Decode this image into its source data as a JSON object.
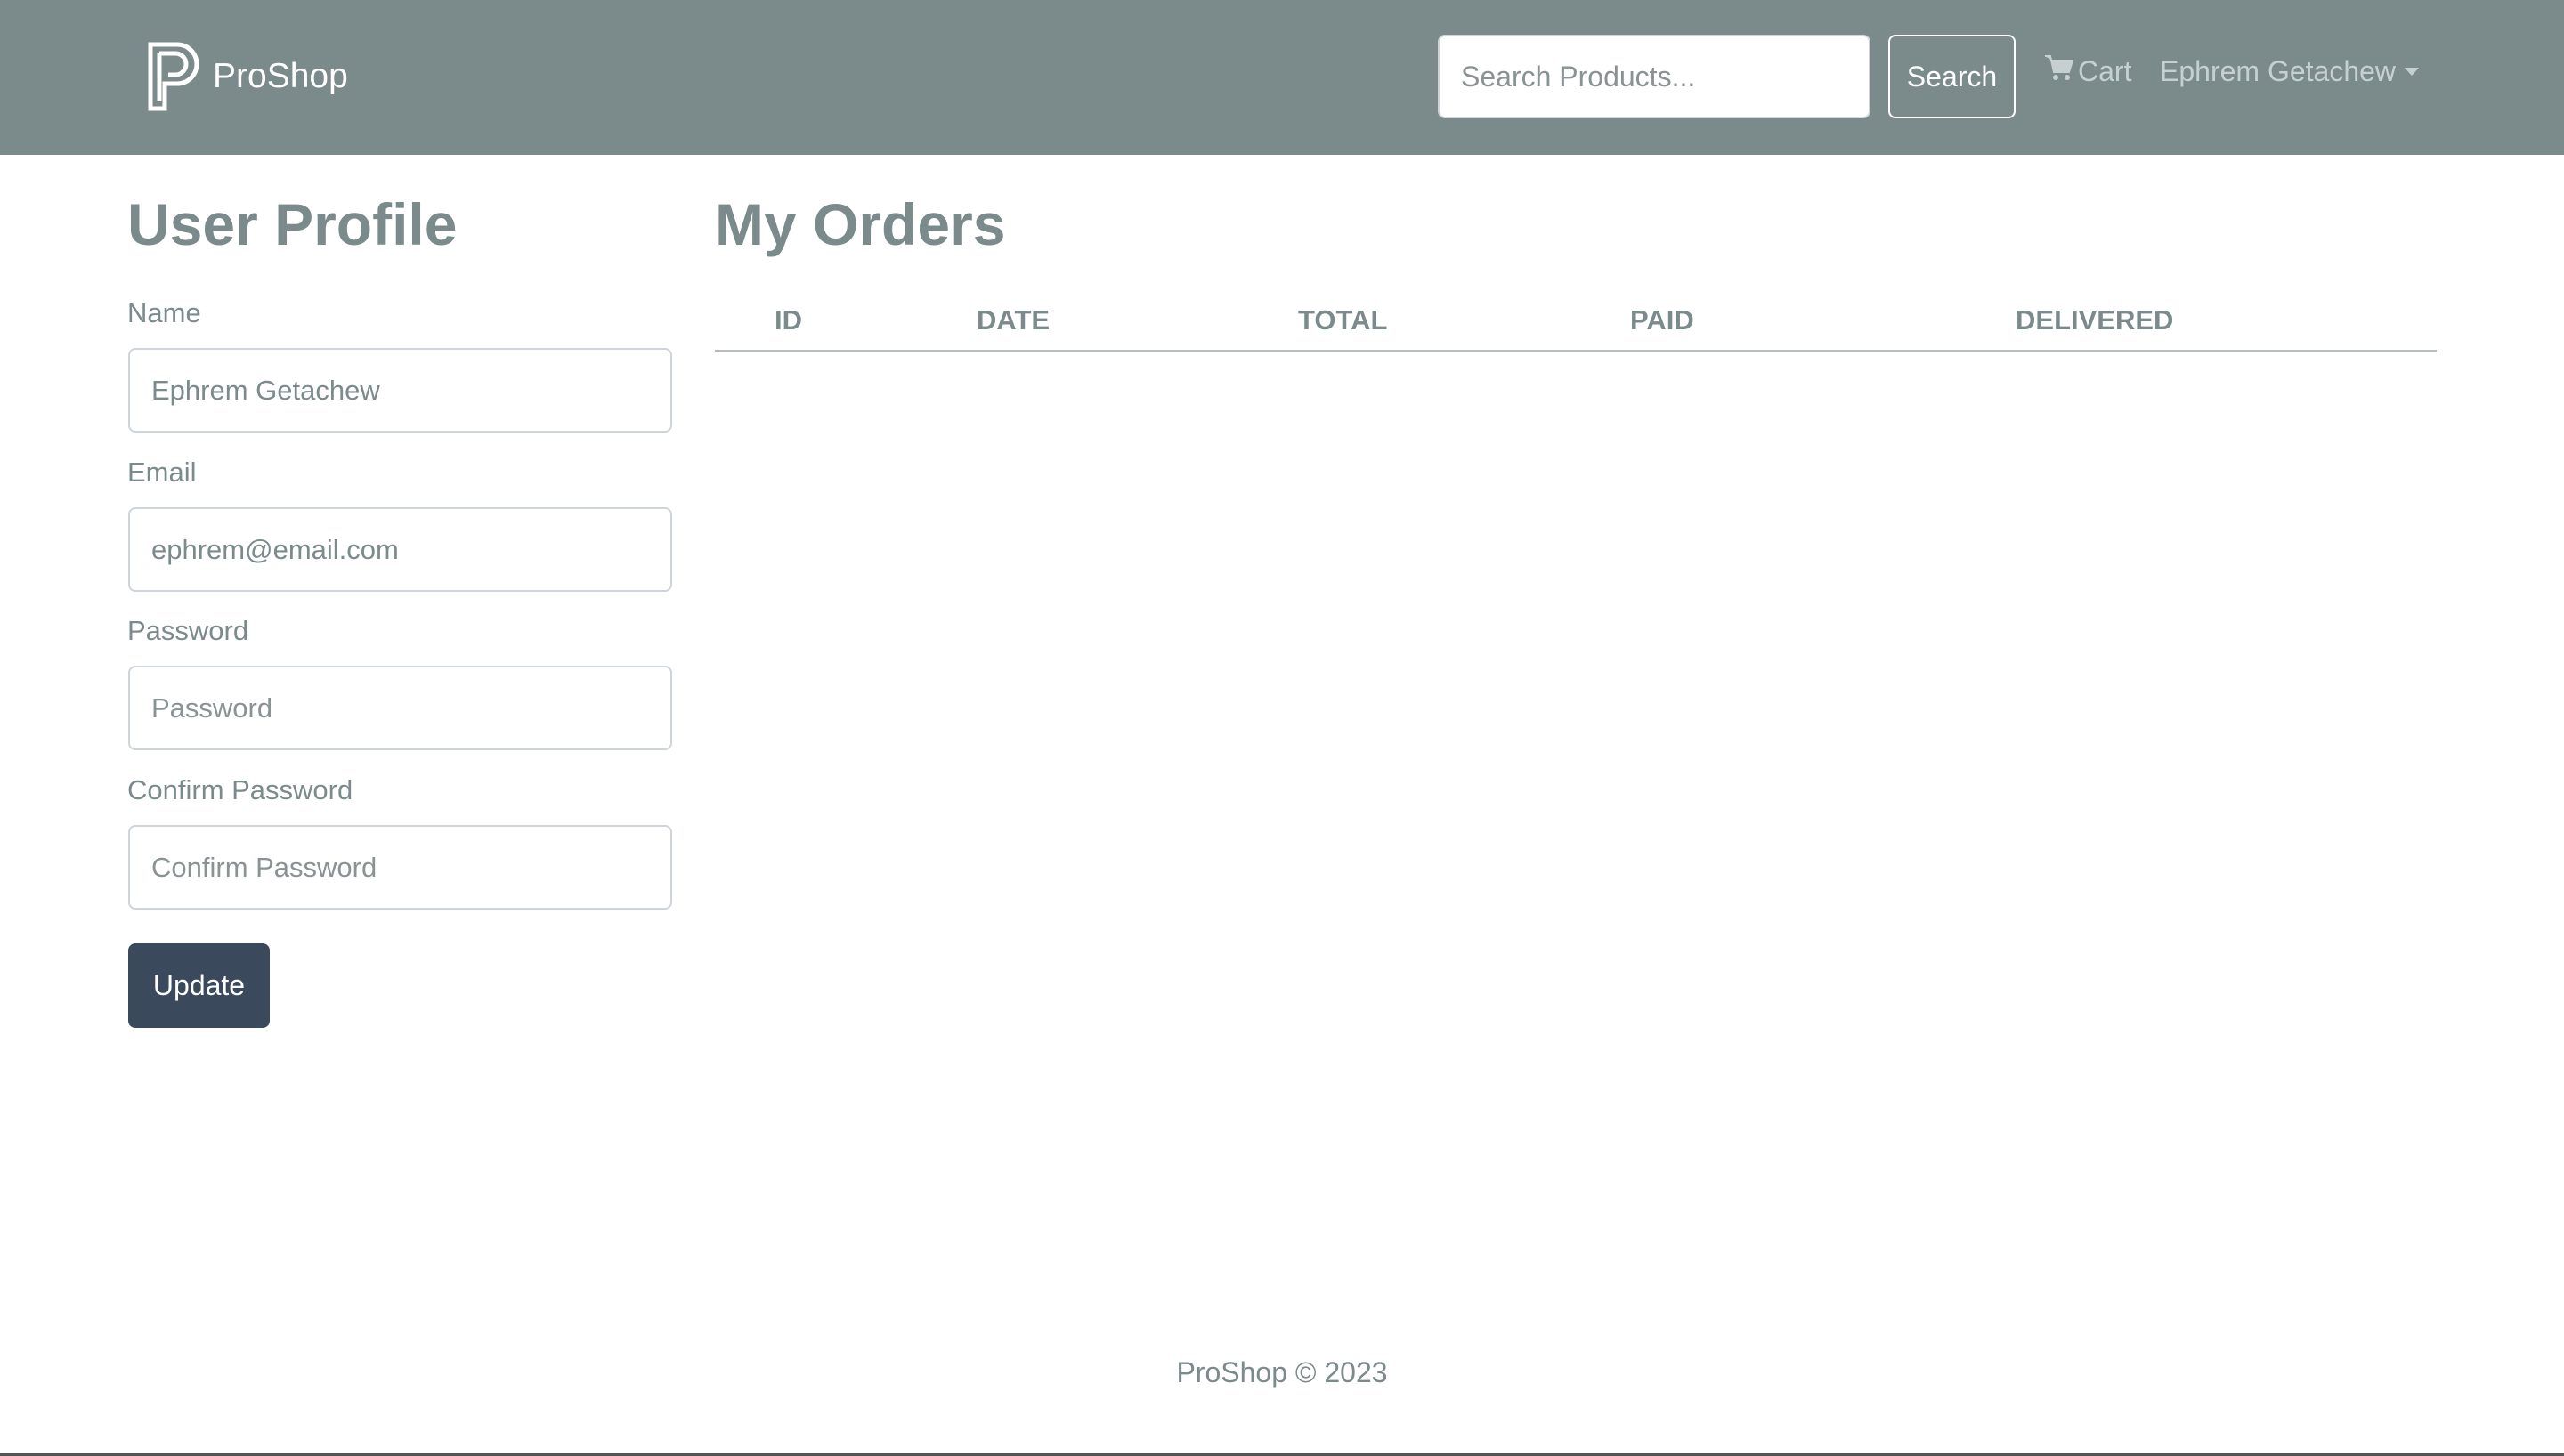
{
  "navbar": {
    "brand": "ProShop",
    "search_placeholder": "Search Products...",
    "search_button": "Search",
    "cart_label": "Cart",
    "user_name": "Ephrem Getachew"
  },
  "profile": {
    "title": "User Profile",
    "fields": [
      {
        "label": "Name",
        "value": "Ephrem Getachew",
        "placeholder": ""
      },
      {
        "label": "Email",
        "value": "ephrem@email.com",
        "placeholder": ""
      },
      {
        "label": "Password",
        "value": "",
        "placeholder": "Password"
      },
      {
        "label": "Confirm Password",
        "value": "",
        "placeholder": "Confirm Password"
      }
    ],
    "update_button": "Update"
  },
  "orders": {
    "title": "My Orders",
    "columns": [
      "ID",
      "DATE",
      "TOTAL",
      "PAID",
      "DELIVERED"
    ],
    "rows": []
  },
  "footer": {
    "text": "ProShop © 2023"
  },
  "colors": {
    "navbar_bg": "#7b8a8b",
    "primary_button": "#3a4a5c",
    "text": "#7b8a8b"
  },
  "icons": {
    "logo": "proshop-logo-icon",
    "cart": "cart-icon",
    "dropdown": "caret-down-icon"
  }
}
